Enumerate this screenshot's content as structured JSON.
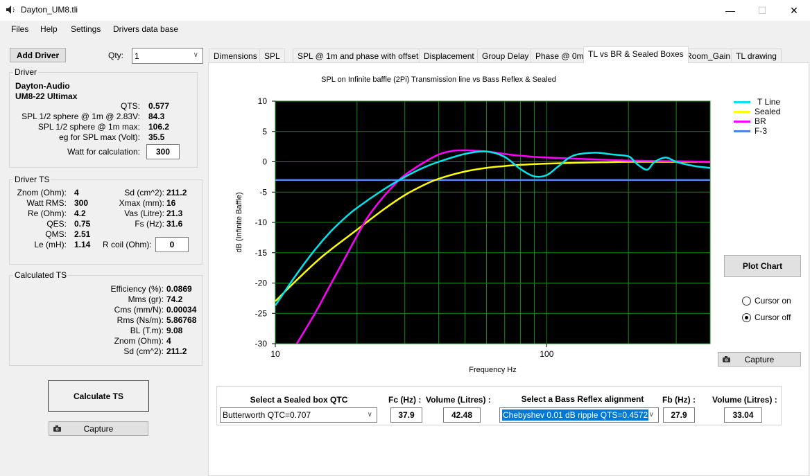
{
  "window": {
    "title": "Dayton_UM8.tli",
    "minimize": "—",
    "maximize": "☐",
    "close": "✕"
  },
  "menu": [
    "Files",
    "Help",
    "Settings",
    "Drivers data base"
  ],
  "toolbar": {
    "add_driver": "Add Driver",
    "qty_label": "Qty:",
    "qty_value": "1"
  },
  "driver": {
    "group_title": "Driver",
    "brand": "Dayton-Audio",
    "model": "UM8-22 Ultimax",
    "rows": [
      {
        "label": "QTS:",
        "value": "0.577"
      },
      {
        "label": "SPL 1/2 sphere @ 1m @ 2.83V:",
        "value": "84.3"
      },
      {
        "label": "SPL 1/2 sphere @ 1m max:",
        "value": "106.2"
      },
      {
        "label": "eg for SPL max (Volt):",
        "value": "35.5"
      }
    ],
    "watt_label": "Watt for calculation:",
    "watt_value": "300"
  },
  "driver_ts": {
    "group_title": "Driver TS",
    "left": [
      {
        "label": "Znom (Ohm):",
        "value": "4"
      },
      {
        "label": "Watt RMS:",
        "value": "300"
      },
      {
        "label": "Re (Ohm):",
        "value": "4.2"
      },
      {
        "label": "QES:",
        "value": "0.75"
      },
      {
        "label": "QMS:",
        "value": "2.51"
      },
      {
        "label": "Le (mH):",
        "value": "1.14"
      }
    ],
    "right": [
      {
        "label": "Sd (cm^2):",
        "value": "211.2"
      },
      {
        "label": "Xmax (mm):",
        "value": "16"
      },
      {
        "label": "Vas (Litre):",
        "value": "21.3"
      },
      {
        "label": "Fs (Hz):",
        "value": "31.6"
      }
    ],
    "rcoil_label": "R coil (Ohm):",
    "rcoil_value": "0"
  },
  "calculated_ts": {
    "group_title": "Calculated TS",
    "rows": [
      {
        "label": "Efficiency (%):",
        "value": "0.0869"
      },
      {
        "label": "Mms (gr):",
        "value": "74.2"
      },
      {
        "label": "Cms (mm/N):",
        "value": "0.00034"
      },
      {
        "label": "Rms (Ns/m):",
        "value": "5.86768"
      },
      {
        "label": "BL (T.m):",
        "value": "9.08"
      },
      {
        "label": "Znom (Ohm):",
        "value": "4"
      },
      {
        "label": "Sd (cm^2):",
        "value": "211.2"
      }
    ]
  },
  "left_buttons": {
    "calculate": "Calculate TS",
    "capture": "Capture"
  },
  "tabs": [
    {
      "label": "Dimensions",
      "active": false
    },
    {
      "label": "SPL",
      "active": false
    },
    {
      "label": "SPL @ 1m and phase with offset",
      "active": false
    },
    {
      "label": "Displacement",
      "active": false
    },
    {
      "label": "Group Delay",
      "active": false
    },
    {
      "label": "Phase @ 0m",
      "active": false
    },
    {
      "label": "TL vs BR & Sealed Boxes",
      "active": true
    },
    {
      "label": "Room_Gain",
      "active": false
    },
    {
      "label": "TL drawing",
      "active": false
    }
  ],
  "right_panel": {
    "plot_chart": "Plot Chart",
    "cursor_on": "Cursor on",
    "cursor_off": "Cursor off",
    "cursor_selected": "off",
    "capture": "Capture"
  },
  "sealed": {
    "title": "Select a Sealed box QTC",
    "selected": "Butterworth QTC=0.707",
    "fc_label": "Fc (Hz) :",
    "fc_value": "37.9",
    "vol_label": "Volume (Litres) :",
    "vol_value": "42.48"
  },
  "bass_reflex": {
    "title": "Select a Bass Reflex alignment",
    "selected": "Chebyshev 0.01 dB ripple QTS=0.4572",
    "fb_label": "Fb (Hz) :",
    "fb_value": "27.9",
    "vol_label": "Volume (Litres) :",
    "vol_value": "33.04"
  },
  "chart_data": {
    "type": "line",
    "title": "SPL on Infinite baffle (2Pi) Transmission line vs Bass Reflex & Sealed",
    "xlabel": "Frequency Hz",
    "ylabel": "dB (Infinite Baffle)",
    "xscale": "log",
    "xlim": [
      10,
      400
    ],
    "ylim": [
      -30,
      10
    ],
    "xticks": [
      10,
      100
    ],
    "yticks": [
      10,
      5,
      0,
      -5,
      -10,
      -15,
      -20,
      -25,
      -30
    ],
    "grid": true,
    "legend_position": "top-right",
    "series": [
      {
        "name": "T Line",
        "color": "#00e5ee",
        "x": [
          10,
          12,
          14,
          16,
          18,
          20,
          25,
          30,
          35,
          40,
          50,
          60,
          70,
          80,
          90,
          100,
          110,
          125,
          150,
          175,
          200,
          210,
          220,
          235,
          250,
          275,
          300,
          350,
          400
        ],
        "y": [
          -23.7,
          -18.5,
          -14.5,
          -11.5,
          -9.3,
          -7.6,
          -4.6,
          -2.5,
          -1.0,
          0.0,
          1.3,
          1.7,
          0.8,
          -1.2,
          -2.4,
          -2.2,
          -0.8,
          1.0,
          1.5,
          1.2,
          0.9,
          0.1,
          -0.7,
          -1.3,
          0.0,
          0.7,
          0.0,
          -0.7,
          -1.0
        ]
      },
      {
        "name": "Sealed",
        "color": "#ffff00",
        "x": [
          10,
          12,
          15,
          20,
          25,
          30,
          35,
          40,
          50,
          60,
          70,
          80,
          100,
          150,
          200,
          300,
          400
        ],
        "y": [
          -23.0,
          -19.5,
          -15.5,
          -11.2,
          -7.9,
          -5.5,
          -3.9,
          -2.8,
          -1.6,
          -1.0,
          -0.7,
          -0.5,
          -0.3,
          -0.1,
          0.0,
          0.0,
          0.0
        ]
      },
      {
        "name": "BR",
        "color": "#ff00ff",
        "x": [
          12,
          14,
          16,
          18,
          20,
          22,
          25,
          28,
          30,
          35,
          40,
          45,
          50,
          60,
          70,
          80,
          100,
          150,
          200,
          300,
          400
        ],
        "y": [
          -30,
          -25,
          -20.2,
          -16.0,
          -12.2,
          -9.0,
          -5.8,
          -3.4,
          -2.2,
          -0.2,
          1.2,
          1.8,
          1.9,
          1.7,
          1.3,
          1.0,
          0.7,
          0.4,
          0.2,
          0.1,
          0.0
        ]
      },
      {
        "name": "F-3",
        "color": "#4a86e8",
        "x": [
          10,
          400
        ],
        "y": [
          -3,
          -3
        ]
      }
    ]
  }
}
